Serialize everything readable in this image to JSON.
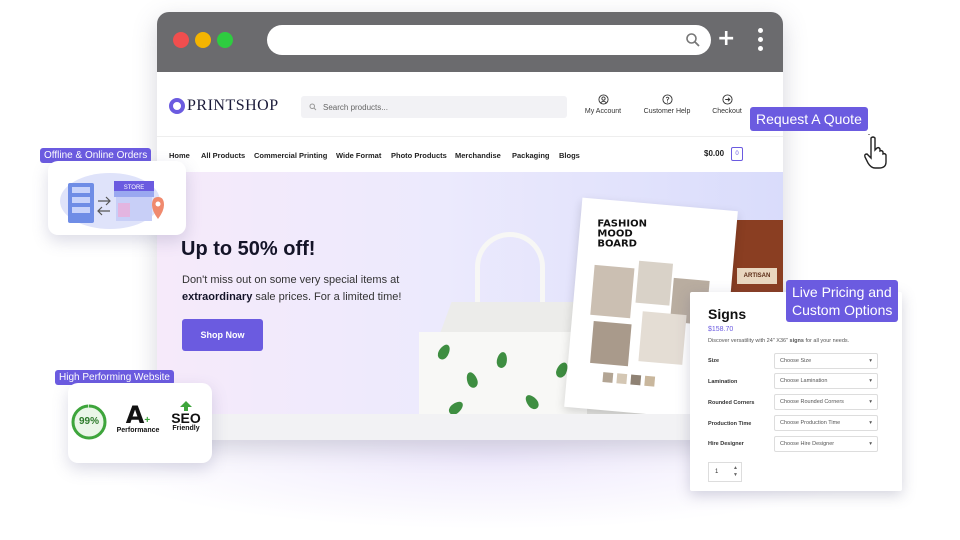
{
  "colors": {
    "accent": "#6b5be0",
    "chrome": "#6b6b6e",
    "red_dot": "#f04e4e",
    "yellow_dot": "#f4b400",
    "green_dot": "#2ecc40"
  },
  "browser": {
    "icons": [
      "search-icon",
      "plus-icon",
      "kebab-menu-icon"
    ]
  },
  "site": {
    "logo": "PRINTSHOP",
    "search_placeholder": "Search products...",
    "header_links": [
      {
        "label": "My Account",
        "icon": "user-icon"
      },
      {
        "label": "Customer Help",
        "icon": "help-icon"
      },
      {
        "label": "Checkout",
        "icon": "checkout-arrow-icon"
      }
    ],
    "nav": [
      "Home",
      "All Products",
      "Commercial Printing",
      "Wide Format",
      "Photo Products",
      "Merchandise",
      "Packaging",
      "Blogs"
    ],
    "cart_total": "$0.00",
    "cart_count": "0"
  },
  "hero": {
    "title": "Up to 50% off!",
    "text_before": "Don't miss out on some very special items at ",
    "text_bold": "extraordinary",
    "text_after": " sale prices. For a limited time!",
    "button": "Shop Now",
    "poster_title": "FASHION MOOD BOARD",
    "coffee_label": "ARTISAN"
  },
  "signs": {
    "title": "Signs",
    "price": "$158.70",
    "desc_before": "Discover versatility with 24\" X36\" ",
    "desc_bold": "signs",
    "desc_after": " for all your needs.",
    "options": [
      {
        "label": "Size",
        "value": "Choose Size"
      },
      {
        "label": "Lamination",
        "value": "Choose Lamination"
      },
      {
        "label": "Rounded Corners",
        "value": "Choose Rounded Corners"
      },
      {
        "label": "Production Time",
        "value": "Choose Production Time"
      },
      {
        "label": "Hire Designer",
        "value": "Choose Hire Designer"
      }
    ],
    "qty": "1"
  },
  "callouts": {
    "offline": "Offline & Online Orders",
    "quote": "Request A Quote",
    "live_pricing_1": "Live Pricing and",
    "live_pricing_2": "Custom Options",
    "performance": "High Performing Website"
  },
  "store_card": {
    "store_sign": "STORE"
  },
  "perf": {
    "score": "99%",
    "grade": "A",
    "grade_plus": "+",
    "grade_label": "Performance",
    "seo": "SEO",
    "seo_label": "Friendly"
  }
}
